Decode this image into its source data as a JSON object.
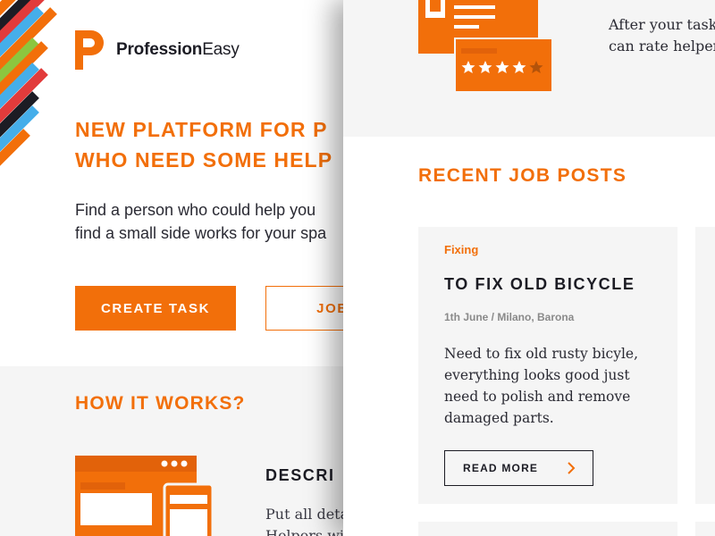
{
  "brand": {
    "name_bold": "Profession",
    "name_regular": "Easy",
    "accent": "#f26f0a"
  },
  "hero": {
    "title_line1": "NEW PLATFORM FOR P",
    "title_line2": "WHO NEED SOME HELP",
    "subtitle_line1": "Find a person who could help you",
    "subtitle_line2": "find a small side works for your spa",
    "create_task_label": "CREATE TASK",
    "jobs_label": "JOB"
  },
  "how_it_works": {
    "title": "HOW IT WORKS?",
    "step_title": "DESCRI",
    "step_text_line1": "Put all deta",
    "step_text_line2": "Helpers wi"
  },
  "rating": {
    "text_line1": "After your task",
    "text_line2": "can rate helper",
    "stars": 4,
    "max_stars": 5
  },
  "recent": {
    "title": "RECENT JOB POSTS",
    "jobs": [
      {
        "category": "Fixing",
        "title": "TO FIX OLD BICYCLE",
        "meta": "1th June / Milano, Barona",
        "description": "Need to fix old rusty bicyle, everything looks good just need to polish and remove damaged parts.",
        "read_more_label": "READ MORE"
      }
    ]
  }
}
